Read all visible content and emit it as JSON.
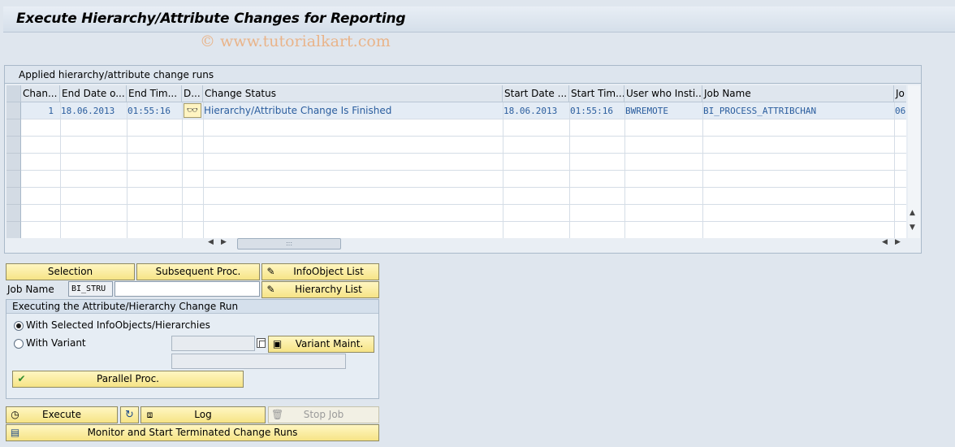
{
  "window": {
    "title": "Execute Hierarchy/Attribute Changes for Reporting",
    "watermark": "© www.tutorialkart.com"
  },
  "grid": {
    "caption": "Applied hierarchy/attribute change runs",
    "columns": [
      "Chan...",
      "End Date o...",
      "End Tim...",
      "D...",
      "Change Status",
      "Start Date ...",
      "Start Tim...",
      "User who Insti...",
      "Job Name",
      "Jo"
    ],
    "rows": [
      {
        "change_run": "1",
        "end_date": "18.06.2013",
        "end_time": "01:55:16",
        "details_icon": "glasses-icon",
        "change_status": "Hierarchy/Attribute Change Is Finished",
        "start_date": "18.06.2013",
        "start_time": "01:55:16",
        "user": "BWREMOTE",
        "job_name": "BI_PROCESS_ATTRIBCHAN",
        "job_count": "06"
      }
    ]
  },
  "toolbar": {
    "selection": "Selection",
    "subsequent": "Subsequent Proc.",
    "infoobject_list": "InfoObject List",
    "hierarchy_list": "Hierarchy List"
  },
  "job_name": {
    "label": "Job Name",
    "prefix": "BI_STRU",
    "value": ""
  },
  "executing": {
    "title": "Executing the Attribute/Hierarchy Change Run",
    "option_selected": "With Selected InfoObjects/Hierarchies",
    "option_variant": "With Variant",
    "selected_option": "With Selected InfoObjects/Hierarchies",
    "variant_value": "",
    "variant_maint": "Variant Maint.",
    "parallel": "Parallel Proc."
  },
  "actions": {
    "execute": "Execute",
    "log": "Log",
    "stop_job": "Stop Job",
    "monitor": "Monitor and Start Terminated Change Runs"
  }
}
